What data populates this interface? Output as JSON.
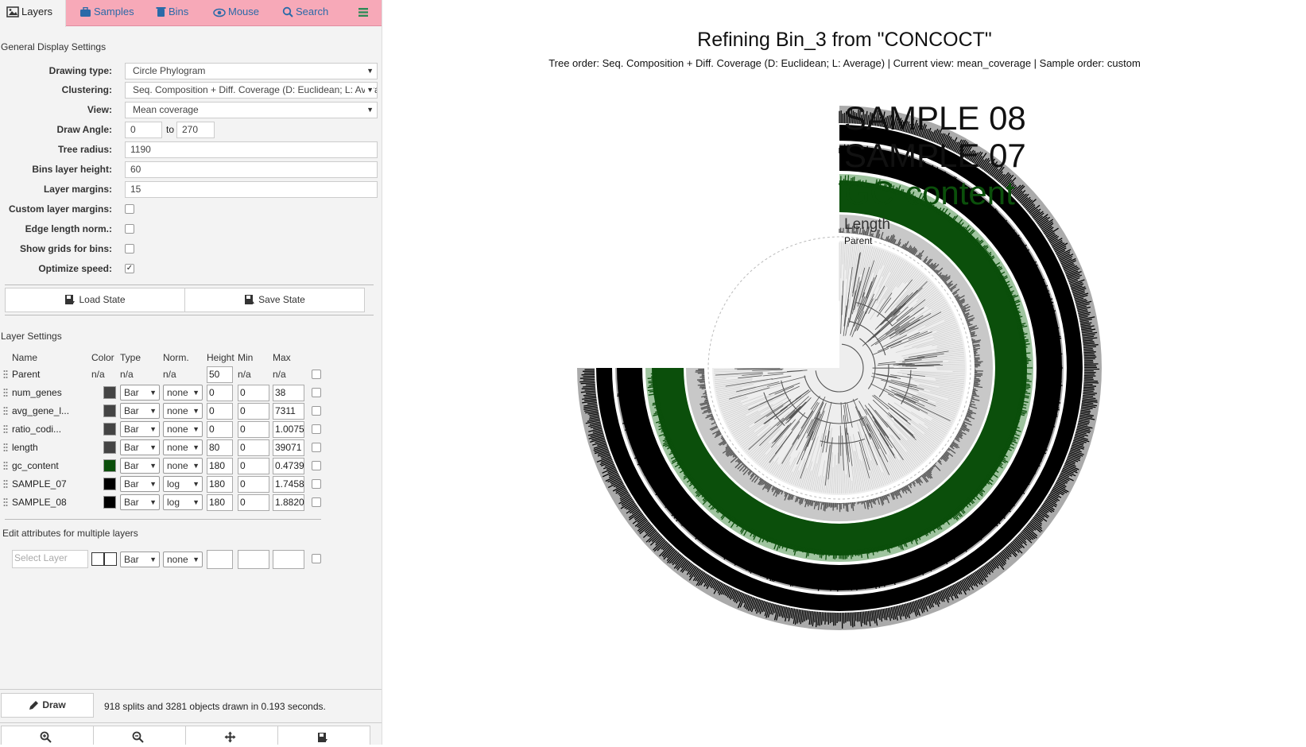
{
  "tabs": [
    {
      "label": "Layers",
      "icon": "image-icon"
    },
    {
      "label": "Samples",
      "icon": "briefcase-icon"
    },
    {
      "label": "Bins",
      "icon": "trash-icon"
    },
    {
      "label": "Mouse",
      "icon": "eye-icon"
    },
    {
      "label": "Search",
      "icon": "search-icon"
    },
    {
      "label": "",
      "icon": "menu-icon"
    }
  ],
  "general": {
    "title": "General Display Settings",
    "drawing_type_label": "Drawing type:",
    "drawing_type_value": "Circle Phylogram",
    "clustering_label": "Clustering:",
    "clustering_value": "Seq. Composition + Diff. Coverage (D: Euclidean; L: Average)",
    "view_label": "View:",
    "view_value": "Mean coverage",
    "angle_label": "Draw Angle:",
    "angle_from": "0",
    "angle_to_word": "to",
    "angle_to": "270",
    "tree_radius_label": "Tree radius:",
    "tree_radius": "1190",
    "bins_height_label": "Bins layer height:",
    "bins_height": "60",
    "layer_margins_label": "Layer margins:",
    "layer_margins": "15",
    "custom_margins_label": "Custom layer margins:",
    "edge_norm_label": "Edge length norm.:",
    "show_grids_label": "Show grids for bins:",
    "optimize_label": "Optimize speed:",
    "optimize_checked": true
  },
  "state": {
    "load_label": "Load State",
    "save_label": "Save State"
  },
  "layer_settings": {
    "title": "Layer Settings",
    "headers": {
      "name": "Name",
      "color": "Color",
      "type": "Type",
      "norm": "Norm.",
      "height": "Height",
      "min": "Min",
      "max": "Max"
    },
    "parent": {
      "name": "Parent",
      "color": "n/a",
      "type": "n/a",
      "norm": "n/a",
      "height": "50",
      "min": "n/a",
      "max": "n/a"
    },
    "rows": [
      {
        "name": "num_genes",
        "color": "#444444",
        "type": "Bar",
        "norm": "none",
        "height": "0",
        "min": "0",
        "max": "38"
      },
      {
        "name": "avg_gene_l...",
        "color": "#444444",
        "type": "Bar",
        "norm": "none",
        "height": "0",
        "min": "0",
        "max": "7311"
      },
      {
        "name": "ratio_codi...",
        "color": "#444444",
        "type": "Bar",
        "norm": "none",
        "height": "0",
        "min": "0",
        "max": "1.0075"
      },
      {
        "name": "length",
        "color": "#444444",
        "type": "Bar",
        "norm": "none",
        "height": "80",
        "min": "0",
        "max": "39071"
      },
      {
        "name": "gc_content",
        "color": "#0b4f0b",
        "type": "Bar",
        "norm": "none",
        "height": "180",
        "min": "0",
        "max": "0.4739"
      },
      {
        "name": "SAMPLE_07",
        "color": "#000000",
        "type": "Bar",
        "norm": "log",
        "height": "180",
        "min": "0",
        "max": "1.7458"
      },
      {
        "name": "SAMPLE_08",
        "color": "#000000",
        "type": "Bar",
        "norm": "log",
        "height": "180",
        "min": "0",
        "max": "1.8820"
      }
    ]
  },
  "multi_edit": {
    "title": "Edit attributes for multiple layers",
    "select_placeholder": "Select Layer",
    "type": "Bar",
    "norm": "none"
  },
  "draw": {
    "label": "Draw",
    "status": "918 splits and 3281 objects drawn in 0.193 seconds."
  },
  "bottom_icons": [
    "zoom-in-icon",
    "zoom-out-icon",
    "center-icon",
    "save-svg-icon"
  ],
  "figure": {
    "title": "Refining Bin_3 from \"CONCOCT\"",
    "subtitle": "Tree order: Seq. Composition + Diff. Coverage (D: Euclidean; L: Average) | Current view: mean_coverage | Sample order: custom",
    "layer_labels": [
      "SAMPLE 08",
      "SAMPLE 07",
      "GC-content",
      "Length",
      "Parent"
    ],
    "colors": {
      "gc": "#0b4f0b",
      "gc_bg": "#9fc49f",
      "sample": "#000000",
      "sample_bg": "#aaaaaa",
      "tree": "#555555"
    }
  }
}
